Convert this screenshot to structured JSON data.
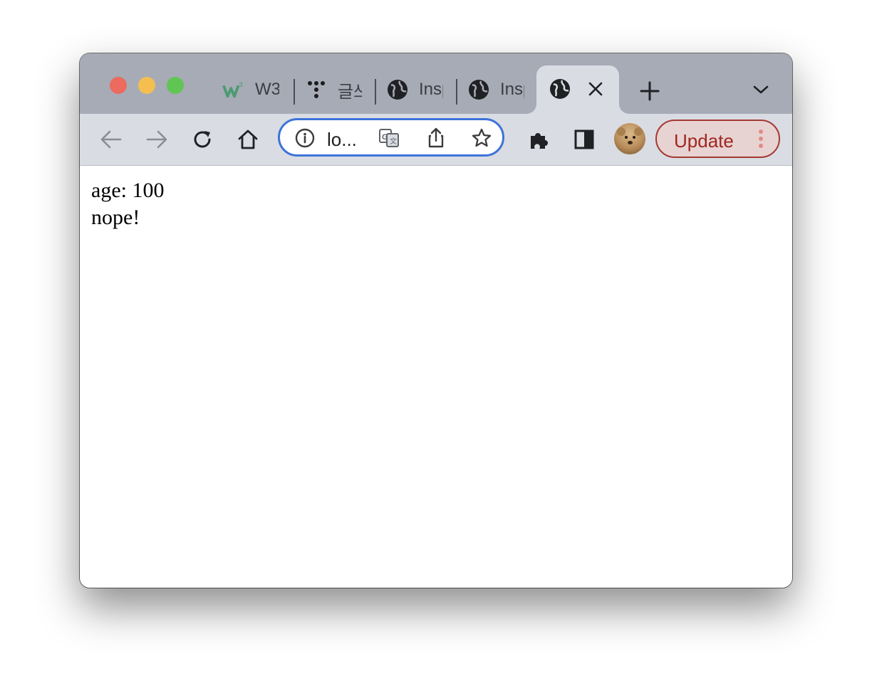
{
  "browser": {
    "tabs": [
      {
        "title": "W3",
        "icon": "w3schools-icon"
      },
      {
        "title": "글쓰",
        "icon": "tistory-icon"
      },
      {
        "title": "Insp",
        "icon": "globe-icon"
      },
      {
        "title": "Insp",
        "icon": "globe-icon"
      },
      {
        "title": "",
        "icon": "globe-icon",
        "active": true
      }
    ],
    "address": "lo...",
    "update_label": "Update",
    "colors": {
      "tabstrip": "#a7abb6",
      "toolbar": "#dadce3",
      "omnibox_border": "#3d73d9",
      "update_text": "#a0271f"
    }
  },
  "page": {
    "lines": [
      "age: 100",
      "nope!"
    ]
  }
}
